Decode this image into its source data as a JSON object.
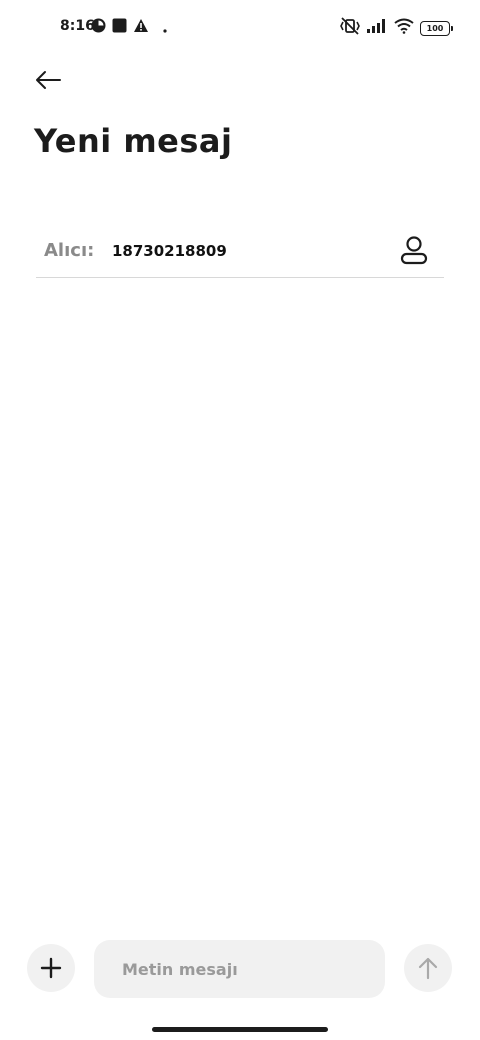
{
  "status_bar": {
    "time": "8:16",
    "battery": "100"
  },
  "header": {
    "title": "Yeni mesaj"
  },
  "recipient": {
    "label": "Alıcı:",
    "value": "18730218809"
  },
  "composer": {
    "placeholder": "Metin mesajı"
  },
  "colors": {
    "text": "#1c1c1c",
    "muted": "#8a8a8a",
    "surface": "#f1f1f1",
    "divider": "#d8d8d8"
  }
}
